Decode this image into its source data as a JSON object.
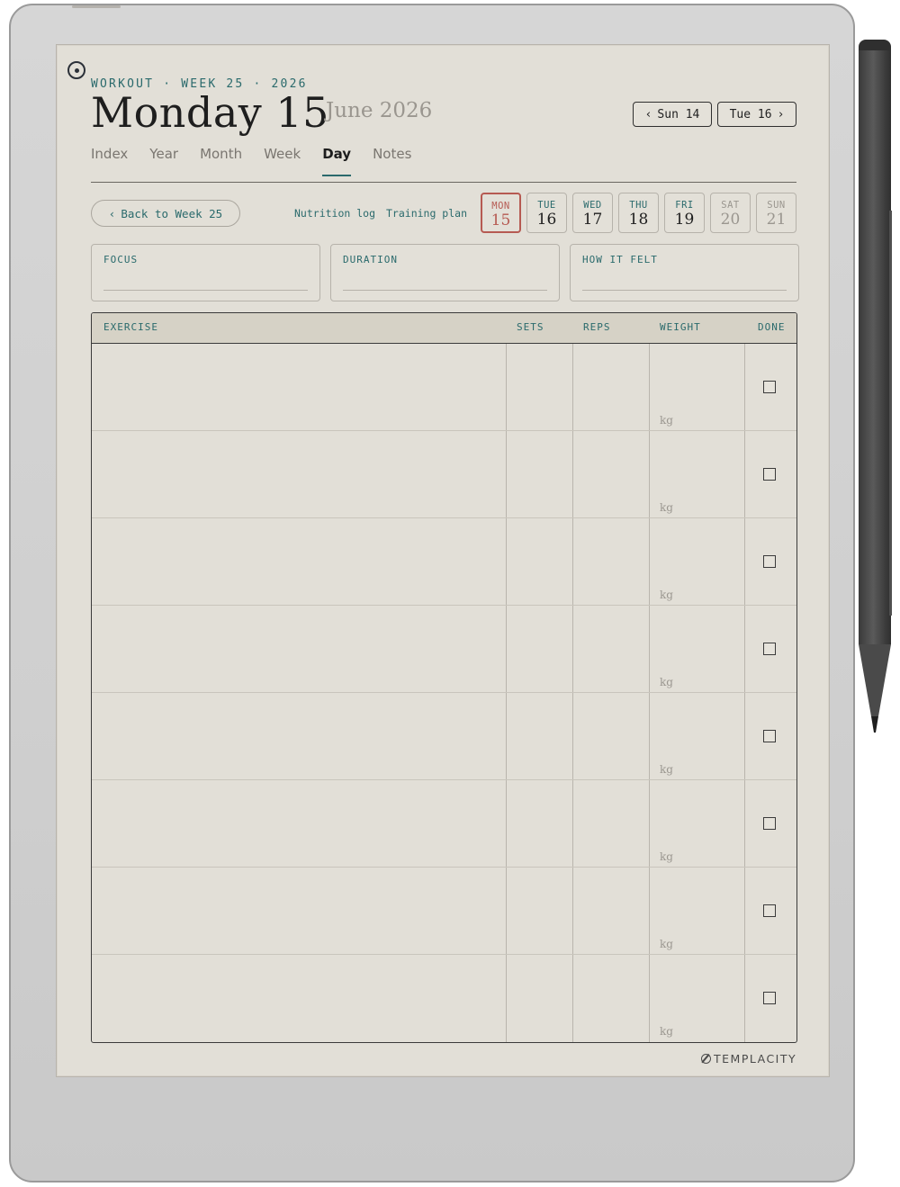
{
  "header": {
    "kicker": "WORKOUT · WEEK 25 · 2026",
    "title": "Monday 15",
    "subtitle": "June 2026",
    "prev_day": "Sun 14",
    "next_day": "Tue 16"
  },
  "tabs": [
    {
      "label": "Index",
      "active": false
    },
    {
      "label": "Year",
      "active": false
    },
    {
      "label": "Month",
      "active": false
    },
    {
      "label": "Week",
      "active": false
    },
    {
      "label": "Day",
      "active": true
    },
    {
      "label": "Notes",
      "active": false
    }
  ],
  "subnav": {
    "back": "Back to Week 25",
    "nutrition": "Nutrition log",
    "training": "Training plan"
  },
  "days": [
    {
      "dow": "MON",
      "num": "15"
    },
    {
      "dow": "TUE",
      "num": "16"
    },
    {
      "dow": "WED",
      "num": "17"
    },
    {
      "dow": "THU",
      "num": "18"
    },
    {
      "dow": "FRI",
      "num": "19"
    },
    {
      "dow": "SAT",
      "num": "20"
    },
    {
      "dow": "SUN",
      "num": "21"
    }
  ],
  "fields": {
    "focus": "FOCUS",
    "duration": "DURATION",
    "felt": "HOW IT FELT"
  },
  "table": {
    "headers": {
      "exercise": "EXERCISE",
      "sets": "SETS",
      "reps": "REPS",
      "weight": "WEIGHT",
      "done": "DONE"
    },
    "unit": "kg",
    "row_count": 8
  },
  "brand": "TEMPLACITY",
  "icons": {
    "menu": "circle-dot-icon",
    "prev": "chevron-left-icon",
    "next": "chevron-right-icon",
    "brand": "templacity-logo-icon"
  },
  "colors": {
    "accent": "#2a6a6c",
    "current_day": "#b65a52",
    "paper": "#e2dfd7",
    "muted": "#9a968f"
  }
}
